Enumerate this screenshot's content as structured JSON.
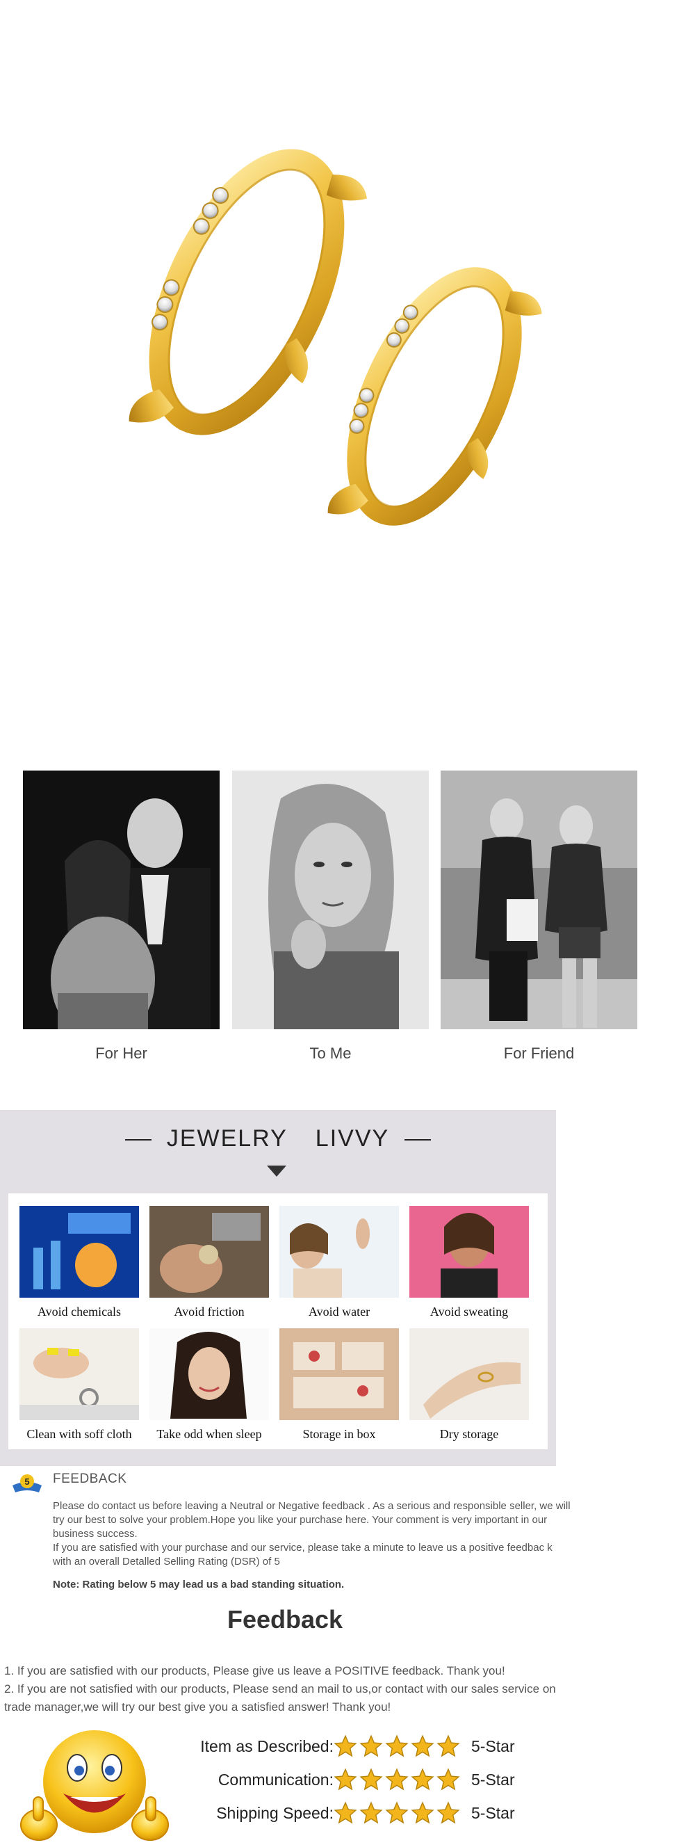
{
  "occasion": {
    "captions": [
      "For Her",
      "To Me",
      "For Friend"
    ]
  },
  "care": {
    "title_left": "JEWELRY",
    "title_right": "LIVVY",
    "items": [
      "Avoid chemicals",
      "Avoid friction",
      "Avoid water",
      "Avoid sweating",
      "Clean with soff cloth",
      "Take odd when sleep",
      "Storage in box",
      "Dry storage"
    ]
  },
  "notice": {
    "badge": "5",
    "title": "FEEDBACK",
    "paragraph1": "Please do contact us before leaving a Neutral or Negative  feedback . As a serious and responsible seller, we will try our best to solve your problem.Hope you like your purchase here. Your comment is very important in our business success.",
    "paragraph2": " If you are satisfied with your purchase and our service,  please take a minute to leave us  a positive feedbac k with an overall  Detalled Selling Rating (DSR) of 5",
    "note": "Note: Rating below 5 may lead us a bad standing situation."
  },
  "feedback": {
    "heading": "Feedback",
    "line1": "1. If you are satisfied with our products, Please give us leave a POSITIVE feedback. Thank you!",
    "line2": "2. If you are not satisfied with our products, Please send an mail to us,or contact with our sales service on trade manager,we will try our best give you a satisfied answer! Thank you!",
    "ratings": [
      {
        "label": "Item as Described:",
        "stars": 5,
        "value": "5-Star"
      },
      {
        "label": "Communication:",
        "stars": 5,
        "value": "5-Star"
      },
      {
        "label": "Shipping Speed:",
        "stars": 5,
        "value": "5-Star"
      }
    ]
  },
  "colors": {
    "gold": "#e3b53a",
    "care_bg": "#e2e0e5",
    "star": "#f2b51c"
  }
}
